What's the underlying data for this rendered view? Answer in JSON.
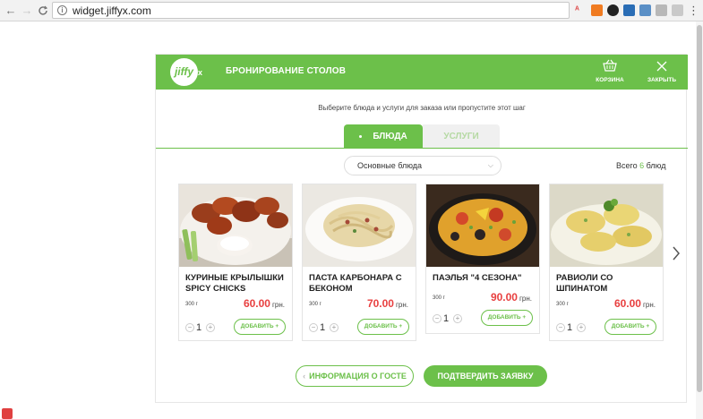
{
  "browser": {
    "url": "widget.jiffyx.com",
    "back_icon": "←",
    "forward_icon": "→",
    "reload_icon": "C",
    "menu_icon": "⋮"
  },
  "widget": {
    "logo_text": "jiffy",
    "logo_suffix": "x",
    "title": "БРОНИРОВАНИЕ СТОЛОВ",
    "cart_label": "КОРЗИНА",
    "close_label": "ЗАКРЫТЬ",
    "subtitle": "Выберите блюда и услуги для заказа или пропустите этот шаг",
    "tabs": [
      {
        "label": "БЛЮДА",
        "active": true
      },
      {
        "label": "УСЛУГИ",
        "active": false
      }
    ],
    "category_select": "Основные блюда",
    "total_prefix": "Всего",
    "total_count": "6",
    "total_suffix": "блюд",
    "accent_color": "#6cc04a",
    "price_color": "#e84040",
    "cards": [
      {
        "name": "КУРИНЫЕ КРЫЛЫШКИ SPICY CHICKS",
        "weight": "300 г",
        "price": "60.00",
        "currency": "грн.",
        "qty": "1",
        "add_label": "ДОБАВИТЬ +"
      },
      {
        "name": "ПАСТА КАРБОНАРА С БЕКОНОМ",
        "weight": "300 г",
        "price": "70.00",
        "currency": "грн.",
        "qty": "1",
        "add_label": "ДОБАВИТЬ +"
      },
      {
        "name": "ПАЭЛЬЯ \"4 СЕЗОНА\"",
        "weight": "300 г",
        "price": "90.00",
        "currency": "грн.",
        "qty": "1",
        "add_label": "ДОБАВИТЬ +"
      },
      {
        "name": "РАВИОЛИ СО ШПИНАТОМ",
        "weight": "300 г",
        "price": "60.00",
        "currency": "грн.",
        "qty": "1",
        "add_label": "ДОБАВИТЬ +"
      }
    ],
    "guest_info_label": "ИНФОРМАЦИЯ О ГОСТЕ",
    "confirm_label": "ПОДТВЕРДИТЬ ЗАЯВКУ"
  }
}
